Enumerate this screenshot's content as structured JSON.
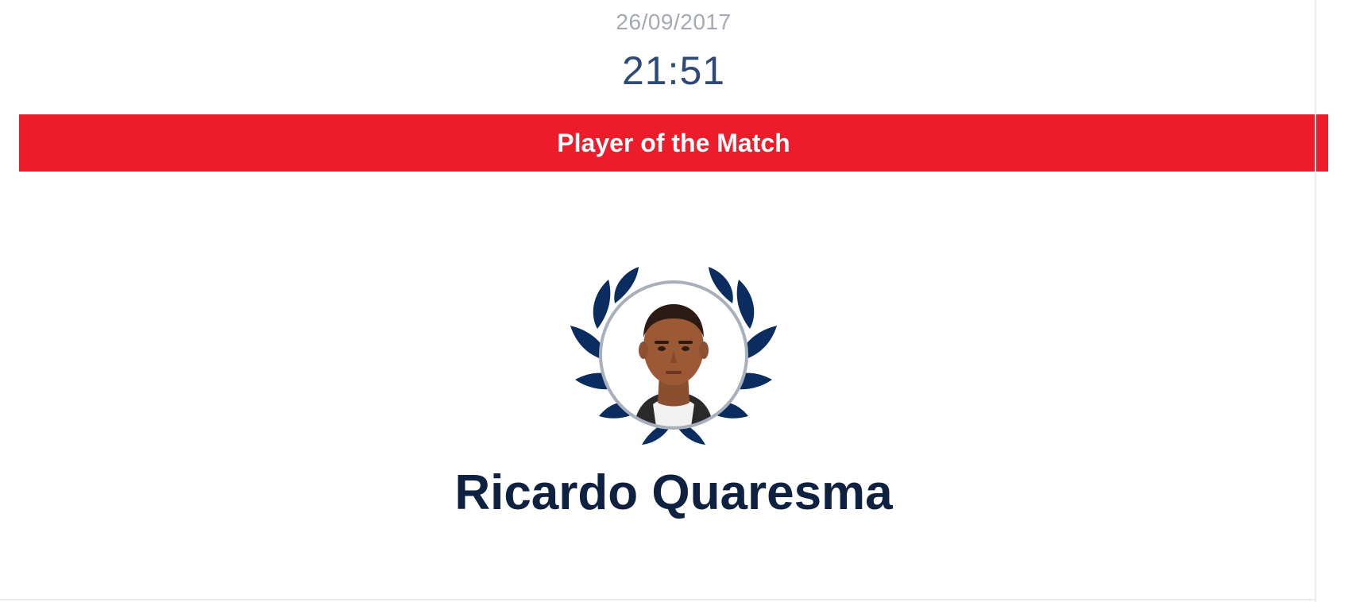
{
  "match": {
    "date": "26/09/2017",
    "time": "21:51"
  },
  "banner": {
    "title": "Player of the Match"
  },
  "player": {
    "name": "Ricardo Quaresma",
    "avatar_icon": "player-portrait",
    "emblem_icon": "laurel-wreath-icon"
  },
  "colors": {
    "banner_red": "#ed1c2a",
    "navy": "#0f2141",
    "laurel_navy": "#0b2c5f",
    "time_blue": "#2d4a7a",
    "date_grey": "#a5a9b2"
  }
}
